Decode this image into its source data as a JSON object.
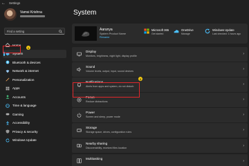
{
  "window": {
    "app_title": "Settings"
  },
  "profile": {
    "name": "Vamsi Krishna"
  },
  "search": {
    "placeholder": "Find a setting"
  },
  "sidebar": {
    "items": [
      {
        "label": "Home",
        "icon": "home-icon",
        "color": "#e8e8e8"
      },
      {
        "label": "System",
        "icon": "system-icon",
        "color": "#4cc2ff",
        "active": true
      },
      {
        "label": "Bluetooth & devices",
        "icon": "bluetooth-icon",
        "color": "#4cc2ff"
      },
      {
        "label": "Network & internet",
        "icon": "network-icon",
        "color": "#9ccfff"
      },
      {
        "label": "Personalization",
        "icon": "brush-icon",
        "color": "#f0a35a"
      },
      {
        "label": "Apps",
        "icon": "apps-icon",
        "color": "#b0b0b0"
      },
      {
        "label": "Accounts",
        "icon": "accounts-icon",
        "color": "#47c27e"
      },
      {
        "label": "Time & language",
        "icon": "globe-icon",
        "color": "#4cc2ff"
      },
      {
        "label": "Gaming",
        "icon": "gaming-icon",
        "color": "#b0b0b0"
      },
      {
        "label": "Accessibility",
        "icon": "accessibility-icon",
        "color": "#4cc2ff"
      },
      {
        "label": "Privacy & security",
        "icon": "shield-icon",
        "color": "#9a9a9a"
      },
      {
        "label": "Windows Update",
        "icon": "update-icon",
        "color": "#4cc2ff"
      }
    ]
  },
  "badges": {
    "system": "1",
    "notifications": "2"
  },
  "main": {
    "title": "System",
    "device": {
      "name": "Aarunya",
      "product": "System Product Name",
      "rename": "Rename"
    },
    "quick": [
      {
        "title": "Microsoft 365",
        "sub": "Get started",
        "icon": "microsoft365-icon"
      },
      {
        "title": "OneDrive",
        "sub": "Manage",
        "icon": "onedrive-icon"
      },
      {
        "title": "Windows Update",
        "sub": "Last checked: 1 hours ago",
        "icon": "update-icon"
      }
    ],
    "rows": [
      {
        "title": "Display",
        "sub": "Monitors, brightness, night light, display profile",
        "icon": "display-icon"
      },
      {
        "title": "Sound",
        "sub": "Volume levels, output, input, sound devices",
        "icon": "sound-icon"
      },
      {
        "title": "Notifications",
        "sub": "Alerts from apps and system, do not disturb",
        "icon": "bell-icon"
      },
      {
        "title": "Focus",
        "sub": "Reduce distractions",
        "icon": "focus-icon"
      },
      {
        "title": "Power",
        "sub": "Screen and sleep, power mode",
        "icon": "power-icon"
      },
      {
        "title": "Storage",
        "sub": "Storage space, drives, configuration rules",
        "icon": "storage-icon"
      },
      {
        "title": "Nearby sharing",
        "sub": "Discoverability, received files location",
        "icon": "nearby-sharing-icon"
      },
      {
        "title": "Multitasking",
        "sub": "",
        "icon": "multitasking-icon"
      }
    ]
  }
}
